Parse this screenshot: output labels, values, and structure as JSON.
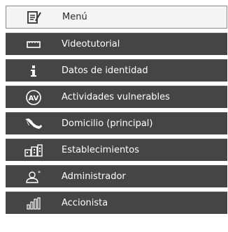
{
  "menu": {
    "header": {
      "label": "Menú",
      "icon": "notepad-edit-icon"
    },
    "items": [
      {
        "label": "Videotutorial",
        "icon": "video-icon"
      },
      {
        "label": "Datos de identidad",
        "icon": "info-icon"
      },
      {
        "label": "Actividades vulnerables",
        "icon": "av-circle-icon"
      },
      {
        "label": "Domicilio (principal)",
        "icon": "mexico-map-icon"
      },
      {
        "label": "Establecimientos",
        "icon": "buildings-icon"
      },
      {
        "label": "Administrador",
        "icon": "user-star-icon"
      },
      {
        "label": "Accionista",
        "icon": "bar-chart-icon"
      }
    ]
  }
}
